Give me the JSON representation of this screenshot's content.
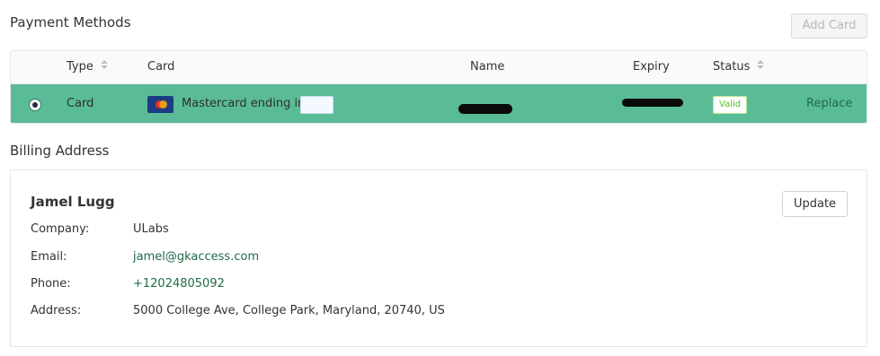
{
  "payment_methods": {
    "title": "Payment Methods",
    "add_card_label": "Add Card",
    "columns": {
      "type": "Type",
      "card": "Card",
      "name": "Name",
      "expiry": "Expiry",
      "status": "Status"
    },
    "rows": [
      {
        "selected": true,
        "type": "Card",
        "card_brand_icon": "mastercard-logo-icon",
        "card_label": "Mastercard ending in",
        "status": "Valid",
        "action": "Replace"
      }
    ]
  },
  "billing_address": {
    "title": "Billing Address",
    "name": "Jamel Lugg",
    "update_label": "Update",
    "fields": [
      {
        "label": "Company:",
        "value": "ULabs"
      },
      {
        "label": "Email:",
        "value": "jamel@gkaccess.com"
      },
      {
        "label": "Phone:",
        "value": "+12024805092"
      },
      {
        "label": "Address:",
        "value": "5000 College Ave, College Park, Maryland, 20740, US"
      }
    ]
  },
  "colors": {
    "selected_row": "#5abc96",
    "link": "#1f6b47",
    "valid_badge": "#52c41a"
  }
}
